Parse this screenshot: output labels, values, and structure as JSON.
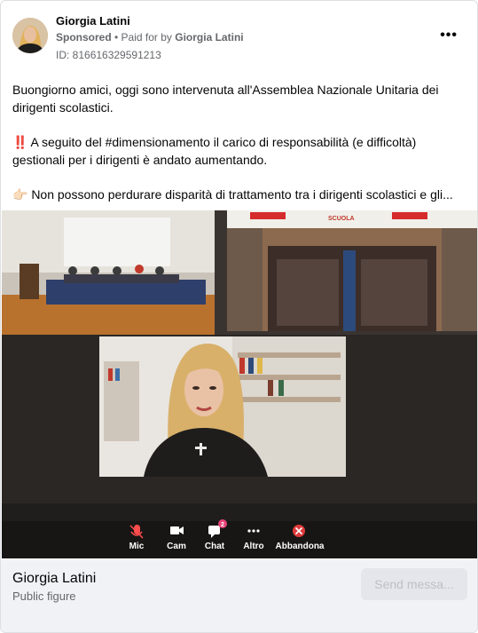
{
  "post": {
    "author": "Giorgia Latini",
    "sponsored_label": "Sponsored",
    "paid_for_prefix": "• Paid for by",
    "paid_for_name": "Giorgia Latini",
    "ad_id": "ID: 816616329591213",
    "more_label": "•••",
    "paragraphs": [
      "Buongiorno amici, oggi sono intervenuta all'Assemblea Nazionale Unitaria dei dirigenti scolastici.",
      "‼️ A seguito del #dimensionamento il carico di responsabilità (e difficoltà) gestionali per i dirigenti è andato aumentando.",
      "👉🏻 Non possono perdurare disparità di trattamento tra i dirigenti scolastici e gli..."
    ]
  },
  "media": {
    "toolbar": [
      {
        "icon": "mic-muted-icon",
        "label": "Mic",
        "color": "#ff4d4d"
      },
      {
        "icon": "camera-icon",
        "label": "Cam",
        "color": "#ffffff"
      },
      {
        "icon": "chat-icon",
        "label": "Chat",
        "badge": "2",
        "color": "#ffffff"
      },
      {
        "icon": "more-icon",
        "label": "Altro",
        "color": "#ffffff"
      },
      {
        "icon": "leave-icon",
        "label": "Abbandona",
        "color": "#e03a3a"
      }
    ],
    "banner_text": "SCUOLA"
  },
  "footer": {
    "page_name": "Giorgia Latini",
    "page_category": "Public figure",
    "send_label": "Send messa..."
  },
  "colors": {
    "accent": "#1877f2",
    "footer_bg": "#f0f2f5",
    "button_bg": "#e4e6eb",
    "muted_text": "#65676b"
  }
}
